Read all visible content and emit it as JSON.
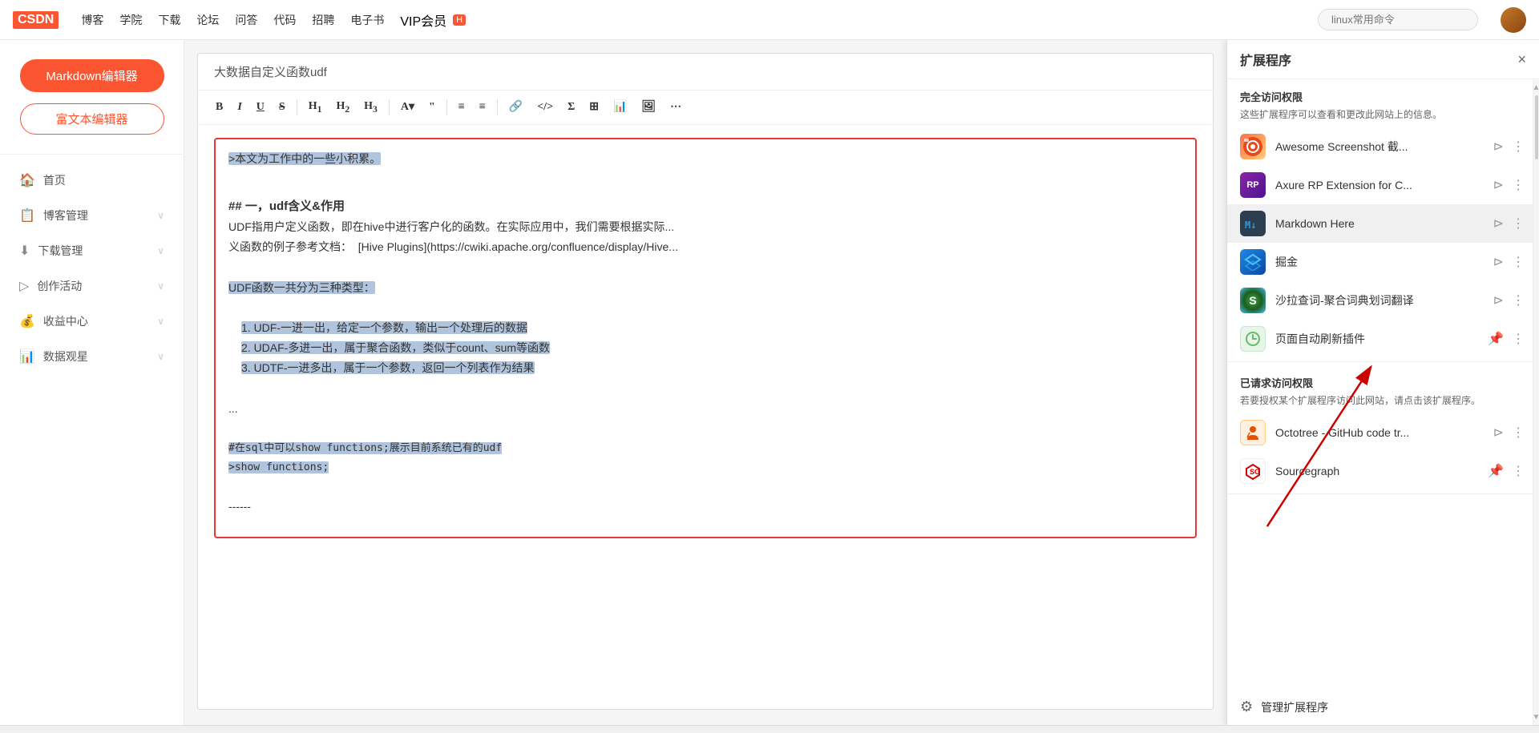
{
  "nav": {
    "logo": "CSDN",
    "links": [
      "博客",
      "学院",
      "下载",
      "论坛",
      "问答",
      "代码",
      "招聘",
      "电子书"
    ],
    "vip": "VIP会员",
    "vip_badge": "H",
    "search_placeholder": "linux常用命令"
  },
  "sidebar": {
    "btn_primary": "Markdown编辑器",
    "btn_secondary": "富文本编辑器",
    "items": [
      {
        "label": "首页",
        "icon": "🏠"
      },
      {
        "label": "博客管理",
        "icon": "📋",
        "has_arrow": true
      },
      {
        "label": "下载管理",
        "icon": "⬇",
        "has_arrow": true
      },
      {
        "label": "创作活动",
        "icon": "▷",
        "has_arrow": true
      },
      {
        "label": "收益中心",
        "icon": "💰",
        "has_arrow": true
      },
      {
        "label": "数据观星",
        "icon": "📊",
        "has_arrow": true
      }
    ]
  },
  "editor": {
    "title": "大数据自定义函数udf",
    "toolbar": [
      "B",
      "I",
      "U",
      "S",
      "H₁",
      "H₂",
      "H₃",
      "A▾",
      "❝",
      "≡",
      "≡",
      "🔗",
      "</>",
      "Σ",
      "⊞",
      "📊",
      "🖼",
      "⋯"
    ],
    "content_lines": [
      {
        "text": ">本文为工作中的一些小积累。",
        "highlight": true,
        "type": "normal"
      },
      {
        "text": "",
        "type": "normal"
      },
      {
        "text": "## 一，udf含义&作用",
        "type": "h2"
      },
      {
        "text": "UDF指用户定义函数，即在hive中进行客户化的函数。在实际应用中，我们需要根据实际...",
        "type": "normal"
      },
      {
        "text": "义函数的例子参考文档：  [Hive Plugins](https://cwiki.apache.org/confluence/display/Hive...",
        "type": "normal"
      },
      {
        "text": "",
        "type": "normal"
      },
      {
        "text": "UDF函数一共分为三种类型：",
        "highlight": true,
        "type": "normal"
      },
      {
        "text": "",
        "type": "normal"
      },
      {
        "text": "1. UDF-一进一出，给定一个参数，输出一个处理后的数据",
        "type": "list",
        "highlight": true
      },
      {
        "text": "2. UDAF-多进一出，属于聚合函数，类似于count、sum等函数",
        "type": "list",
        "highlight": true
      },
      {
        "text": "3. UDTF-一进多出，属于一个参数，返回一个列表作为结果",
        "type": "list",
        "highlight": true
      },
      {
        "text": "",
        "type": "normal"
      },
      {
        "text": "...",
        "type": "normal"
      },
      {
        "text": "",
        "type": "normal"
      },
      {
        "text": "#在sql中可以show functions;展示目前系统已有的udf",
        "highlight": true,
        "type": "code"
      },
      {
        "text": ">show functions;",
        "highlight": true,
        "type": "code"
      },
      {
        "text": "",
        "type": "normal"
      },
      {
        "text": "------",
        "type": "normal"
      }
    ]
  },
  "extension_panel": {
    "title": "扩展程序",
    "close_label": "×",
    "full_access_title": "完全访问权限",
    "full_access_desc": "这些扩展程序可以查看和更改此网站上的信息。",
    "extensions_full": [
      {
        "name": "Awesome Screenshot 截...",
        "icon_type": "awesome",
        "icon_char": "📷",
        "pinned": false,
        "id": "awesome-screenshot"
      },
      {
        "name": "Axure RP Extension for C...",
        "icon_type": "axure",
        "icon_char": "Ax",
        "pinned": false,
        "id": "axure-rp"
      },
      {
        "name": "Markdown Here",
        "icon_type": "markdown",
        "icon_char": "M↓",
        "pinned": false,
        "active": true,
        "id": "markdown-here"
      },
      {
        "name": "掘金",
        "icon_type": "juejin",
        "icon_char": "⬡",
        "pinned": false,
        "id": "juejin"
      },
      {
        "name": "沙拉查词-聚合词典划词翻译",
        "icon_type": "salad",
        "icon_char": "S",
        "pinned": false,
        "id": "salad"
      },
      {
        "name": "页面自动刷新插件",
        "icon_type": "refresh",
        "icon_char": "↻",
        "pinned": true,
        "id": "page-refresh"
      }
    ],
    "limited_access_title": "已请求访问权限",
    "limited_access_desc": "若要授权某个扩展程序访问此网站，请点击该扩展程序。",
    "extensions_limited": [
      {
        "name": "Octotree - GitHub code tr...",
        "icon_type": "octotree",
        "icon_char": "🌲",
        "pinned": false,
        "id": "octotree"
      },
      {
        "name": "Sourcegraph",
        "icon_type": "source",
        "icon_char": "✳",
        "pinned": true,
        "id": "sourcegraph"
      }
    ],
    "manage_label": "管理扩展程序"
  }
}
